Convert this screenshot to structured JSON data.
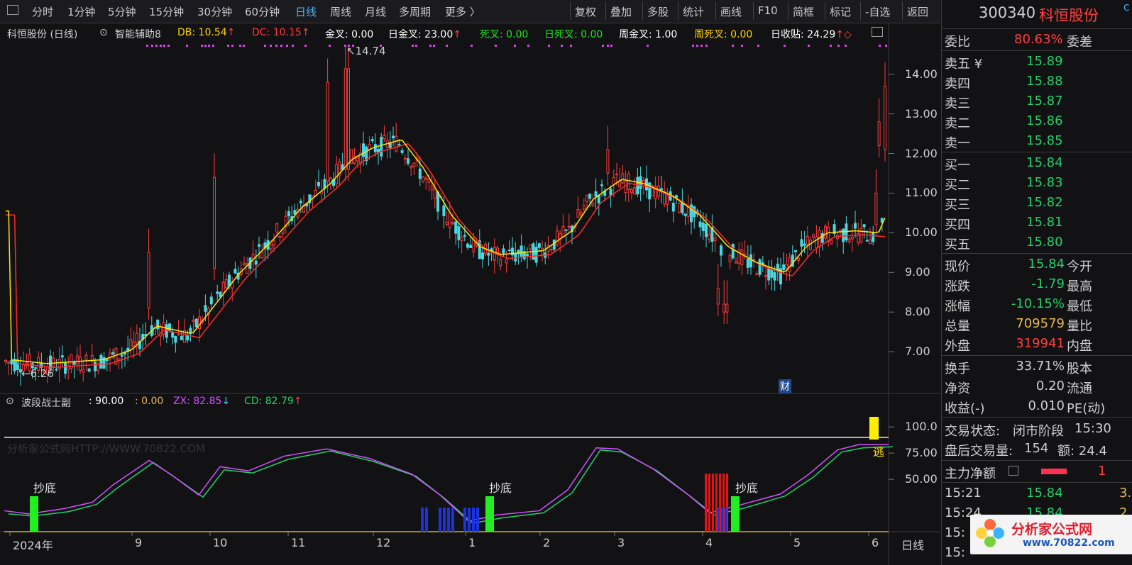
{
  "toolbar": {
    "items": [
      "分时",
      "1分钟",
      "5分钟",
      "15分钟",
      "30分钟",
      "60分钟",
      "日线",
      "周线",
      "月线",
      "多周期",
      "更多 〉"
    ],
    "active_item": "日线",
    "buttons": [
      "复权",
      "叠加",
      "多股",
      "统计",
      "画线",
      "F10",
      "简框",
      "标记",
      "-自选",
      "返回"
    ]
  },
  "main_chart": {
    "title": "科恒股份 (日线)",
    "indicator_name": "智能辅助8",
    "values": [
      {
        "label": "DB: 10.54",
        "arrow": "↑",
        "color": "#ffd400"
      },
      {
        "label": "DC: 10.15",
        "arrow": "↑",
        "color": "#ff3b3b"
      },
      {
        "label": "金叉: 0.00",
        "arrow": "",
        "color": "#ffffff"
      },
      {
        "label": "日金叉: 23.00",
        "arrow": "↑",
        "color": "#ffffff"
      },
      {
        "label": "死叉: 0.00",
        "arrow": "",
        "color": "#22e022"
      },
      {
        "label": "日死叉: 0.00",
        "arrow": "",
        "color": "#22e022"
      },
      {
        "label": "周金叉: 1.00",
        "arrow": "",
        "color": "#ffffff"
      },
      {
        "label": "周死叉: 0.00",
        "arrow": "",
        "color": "#ffd400"
      },
      {
        "label": "日收贴: 24.29",
        "arrow": "↑◇",
        "color": "#ffffff"
      }
    ],
    "high_marker": "14.74",
    "low_marker": "6.26",
    "fin_badge": "财",
    "y_ticks": [
      "14.00",
      "13.00",
      "12.00",
      "11.00",
      "10.00",
      "9.00",
      "8.00",
      "7.00"
    ]
  },
  "sub_chart": {
    "title": "波段战士副",
    "value_main": ": 90.00",
    "value_b": ": 0.00",
    "zx_label": "ZX: 82.85",
    "zx_arrow": "↓",
    "cd_label": "CD: 82.79",
    "cd_arrow": "↑",
    "watermark": "分析家公式网HTTP://WWW.70822.COM",
    "annotations": [
      "抄底",
      "抄底",
      "抄底",
      "逃"
    ],
    "y_ticks": [
      "100.0",
      "75.00",
      "50.00"
    ]
  },
  "x_axis": {
    "labels": [
      "2024年",
      "9",
      "10",
      "11",
      "12",
      "1",
      "2",
      "3",
      "4",
      "5",
      "6"
    ],
    "period_label": "日线"
  },
  "quote": {
    "code": "300340",
    "name": "科恒股份",
    "badge": "C",
    "weibi_label": "委比",
    "weibi_value": "80.63%",
    "weicha_label": "委差",
    "asks": [
      {
        "label": "卖五 ¥",
        "price": "15.89"
      },
      {
        "label": "卖四",
        "price": "15.88"
      },
      {
        "label": "卖三",
        "price": "15.87"
      },
      {
        "label": "卖二",
        "price": "15.86"
      },
      {
        "label": "卖一",
        "price": "15.85"
      }
    ],
    "bids": [
      {
        "label": "买一",
        "price": "15.84"
      },
      {
        "label": "买二",
        "price": "15.83"
      },
      {
        "label": "买三",
        "price": "15.82"
      },
      {
        "label": "买四",
        "price": "15.81"
      },
      {
        "label": "买五",
        "price": "15.80"
      }
    ],
    "stats": [
      {
        "label": "现价",
        "value": "15.84",
        "color": "#22d06a",
        "right": "今开"
      },
      {
        "label": "涨跌",
        "value": "-1.79",
        "color": "#22d06a",
        "right": "最高"
      },
      {
        "label": "涨幅",
        "value": "-10.15%",
        "color": "#22d06a",
        "right": "最低"
      },
      {
        "label": "总量",
        "value": "709579",
        "color": "#e6b84a",
        "right": "量比"
      },
      {
        "label": "外盘",
        "value": "319941",
        "color": "#ff4040",
        "right": "内盘"
      }
    ],
    "stats2": [
      {
        "label": "换手",
        "value": "33.71%",
        "right": "股本"
      },
      {
        "label": "净资",
        "value": "0.20",
        "right": "流通"
      },
      {
        "label": "收益(-)",
        "value": "0.010",
        "right": "PE(动)"
      }
    ],
    "trade_status_label": "交易状态:",
    "trade_status_value": "闭市阶段",
    "trade_status_time": "15:30",
    "after_hours_label": "盘后交易量:",
    "after_hours_value": "154",
    "after_hours_amt": "额: 24.4",
    "main_net_label": "主力净额",
    "main_net_value": "1",
    "ticks": [
      {
        "time": "15:21",
        "price": "15.84",
        "vol": "3."
      },
      {
        "time": "15:24",
        "price": "15.84",
        "vol": "2."
      },
      {
        "time": "15:",
        "price": "",
        "vol": ""
      },
      {
        "time": "15:",
        "price": "",
        "vol": ""
      }
    ],
    "logo_text": "分析家公式网",
    "logo_url": "www.70822.com"
  },
  "chart_data": {
    "type": "candlestick",
    "y_range": [
      6.0,
      14.8
    ],
    "sub_y_range": [
      0,
      115
    ],
    "months": [
      "2024年",
      "9",
      "10",
      "11",
      "12",
      "1",
      "2",
      "3",
      "4",
      "5",
      "6"
    ],
    "high": 14.74,
    "low": 6.26,
    "ma_yellow_last": 10.54,
    "ma_red_last": 10.15,
    "zx_last": 82.85,
    "cd_last": 82.79,
    "sub_reference_line": 90
  }
}
